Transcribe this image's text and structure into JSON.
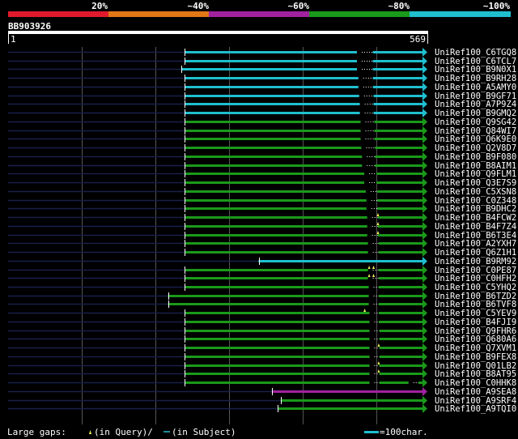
{
  "colors": {
    "background": "#000000",
    "dark_line": "#1a1f4a",
    "cyan": "#1fbfcf",
    "green": "#1a9a1a",
    "purple": "#a0229f",
    "red": "#e01a2c",
    "orange": "#e07818",
    "grid": "#555555",
    "white": "#ffffff"
  },
  "header": {
    "scale_labels": [
      "20%",
      "~40%",
      "~60%",
      "~80%",
      "~100%"
    ],
    "scale_colors": [
      "#e01a2c",
      "#e07818",
      "#a0229f",
      "#1a9a1a",
      "#1fbfcf"
    ],
    "query_id": "BB903926",
    "query_start": "1",
    "query_end": "569"
  },
  "footer": {
    "gaps_prefix": "Large gaps:",
    "gaps_query": "(in Query)/",
    "gaps_subject": "(in Subject)",
    "scale_text": "=100char."
  },
  "chart_data": {
    "type": "alignment",
    "query_length": 569,
    "rows": [
      {
        "label": "UniRef100_C6TGQ8",
        "color": "cyan",
        "start": 240,
        "end": 569,
        "dash": [
          480,
          495
        ],
        "query_gaps": [],
        "subject_gaps": []
      },
      {
        "label": "UniRef100_C6TCL7",
        "color": "cyan",
        "start": 240,
        "end": 569,
        "dash": [
          480,
          495
        ],
        "query_gaps": [],
        "subject_gaps": []
      },
      {
        "label": "UniRef100_B9N0X1",
        "color": "cyan",
        "start": 235,
        "end": 569,
        "dash": [
          480,
          495
        ],
        "query_gaps": [],
        "subject_gaps": []
      },
      {
        "label": "UniRef100_B9RH28",
        "color": "cyan",
        "start": 240,
        "end": 569,
        "dash": [
          482,
          495
        ],
        "query_gaps": [],
        "subject_gaps": []
      },
      {
        "label": "UniRef100_A5AMY0",
        "color": "cyan",
        "start": 240,
        "end": 569,
        "dash": [
          482,
          495
        ],
        "query_gaps": [],
        "subject_gaps": []
      },
      {
        "label": "UniRef100_B9GF71",
        "color": "cyan",
        "start": 240,
        "end": 569,
        "dash": [
          483,
          496
        ],
        "query_gaps": [],
        "subject_gaps": []
      },
      {
        "label": "UniRef100_A7P9Z4",
        "color": "cyan",
        "start": 240,
        "end": 569,
        "dash": [
          484,
          496
        ],
        "query_gaps": [],
        "subject_gaps": []
      },
      {
        "label": "UniRef100_B9GMQ2",
        "color": "cyan",
        "start": 240,
        "end": 569,
        "dash": [
          484,
          496
        ],
        "query_gaps": [],
        "subject_gaps": []
      },
      {
        "label": "UniRef100_Q9SG42",
        "color": "green",
        "start": 240,
        "end": 569,
        "dash": [
          485,
          497
        ],
        "query_gaps": [],
        "subject_gaps": []
      },
      {
        "label": "UniRef100_Q84WI7",
        "color": "green",
        "start": 240,
        "end": 569,
        "dash": [
          485,
          497
        ],
        "query_gaps": [],
        "subject_gaps": []
      },
      {
        "label": "UniRef100_Q6K9E0",
        "color": "green",
        "start": 240,
        "end": 569,
        "dash": [
          485,
          497
        ],
        "query_gaps": [],
        "subject_gaps": []
      },
      {
        "label": "UniRef100_Q2V8D7",
        "color": "green",
        "start": 240,
        "end": 569,
        "dash": [
          486,
          498
        ],
        "query_gaps": [],
        "subject_gaps": []
      },
      {
        "label": "UniRef100_B9F080",
        "color": "green",
        "start": 240,
        "end": 569,
        "dash": [
          487,
          498
        ],
        "query_gaps": [],
        "subject_gaps": []
      },
      {
        "label": "UniRef100_B8AIM1",
        "color": "green",
        "start": 240,
        "end": 569,
        "dash": [
          487,
          498
        ],
        "query_gaps": [],
        "subject_gaps": []
      },
      {
        "label": "UniRef100_Q9FLM1",
        "color": "green",
        "start": 240,
        "end": 569,
        "dash": [
          490,
          500
        ],
        "query_gaps": [],
        "subject_gaps": []
      },
      {
        "label": "UniRef100_Q3E7S9",
        "color": "green",
        "start": 240,
        "end": 569,
        "dash": [
          490,
          500
        ],
        "query_gaps": [],
        "subject_gaps": []
      },
      {
        "label": "UniRef100_C5XSN8",
        "color": "green",
        "start": 240,
        "end": 569,
        "dash": [
          492,
          501
        ],
        "query_gaps": [],
        "subject_gaps": []
      },
      {
        "label": "UniRef100_C0Z348",
        "color": "green",
        "start": 240,
        "end": 569,
        "dash": [
          493,
          501
        ],
        "query_gaps": [],
        "subject_gaps": []
      },
      {
        "label": "UniRef100_B9DHC2",
        "color": "green",
        "start": 240,
        "end": 569,
        "dash": [
          493,
          501
        ],
        "query_gaps": [],
        "subject_gaps": []
      },
      {
        "label": "UniRef100_B4FCW2",
        "color": "green",
        "start": 240,
        "end": 569,
        "dash": [
          494,
          502
        ],
        "query_gaps": [
          502
        ],
        "subject_gaps": []
      },
      {
        "label": "UniRef100_B4F7Z4",
        "color": "green",
        "start": 240,
        "end": 569,
        "dash": [
          494,
          502
        ],
        "query_gaps": [
          502
        ],
        "subject_gaps": []
      },
      {
        "label": "UniRef100_B6T3E4",
        "color": "green",
        "start": 240,
        "end": 569,
        "dash": [
          494,
          502
        ],
        "query_gaps": [
          502
        ],
        "subject_gaps": []
      },
      {
        "label": "UniRef100_A2YXH7",
        "color": "green",
        "start": 240,
        "end": 569,
        "dash": [
          495,
          503
        ],
        "query_gaps": [],
        "subject_gaps": []
      },
      {
        "label": "UniRef100_Q6Z1H1",
        "color": "green",
        "start": 240,
        "end": 569,
        "dash": [
          495,
          503
        ],
        "query_gaps": [],
        "subject_gaps": []
      },
      {
        "label": "UniRef100_B9RM92",
        "color": "cyan",
        "start": 340,
        "end": 569,
        "dash": [],
        "query_gaps": [],
        "subject_gaps": []
      },
      {
        "label": "UniRef100_C0PE87",
        "color": "green",
        "start": 240,
        "end": 569,
        "dash": [
          495,
          503
        ],
        "query_gaps": [
          490,
          496
        ],
        "subject_gaps": []
      },
      {
        "label": "UniRef100_C0HFH2",
        "color": "green",
        "start": 240,
        "end": 569,
        "dash": [
          495,
          503
        ],
        "query_gaps": [
          490,
          496
        ],
        "subject_gaps": []
      },
      {
        "label": "UniRef100_C5YHQ2",
        "color": "green",
        "start": 240,
        "end": 569,
        "dash": [
          496,
          503
        ],
        "query_gaps": [],
        "subject_gaps": []
      },
      {
        "label": "UniRef100_B6TZD2",
        "color": "green",
        "start": 217,
        "end": 569,
        "dash": [
          496,
          503
        ],
        "query_gaps": [],
        "subject_gaps": []
      },
      {
        "label": "UniRef100_B6TVF8",
        "color": "green",
        "start": 217,
        "end": 569,
        "dash": [
          496,
          503
        ],
        "query_gaps": [],
        "subject_gaps": []
      },
      {
        "label": "UniRef100_C5YEV9",
        "color": "green",
        "start": 240,
        "end": 569,
        "dash": [
          497,
          503
        ],
        "query_gaps": [
          484
        ],
        "subject_gaps": []
      },
      {
        "label": "UniRef100_B4FJI9",
        "color": "green",
        "start": 240,
        "end": 569,
        "dash": [
          497,
          503
        ],
        "query_gaps": [],
        "subject_gaps": []
      },
      {
        "label": "UniRef100_Q9FHR6",
        "color": "green",
        "start": 240,
        "end": 569,
        "dash": [
          497,
          504
        ],
        "query_gaps": [],
        "subject_gaps": []
      },
      {
        "label": "UniRef100_Q680A6",
        "color": "green",
        "start": 240,
        "end": 569,
        "dash": [
          497,
          504
        ],
        "query_gaps": [],
        "subject_gaps": []
      },
      {
        "label": "UniRef100_Q7XVM1",
        "color": "green",
        "start": 240,
        "end": 569,
        "dash": [
          497,
          504
        ],
        "query_gaps": [
          503
        ],
        "subject_gaps": []
      },
      {
        "label": "UniRef100_B9FEX8",
        "color": "green",
        "start": 240,
        "end": 569,
        "dash": [
          497,
          504
        ],
        "query_gaps": [],
        "subject_gaps": []
      },
      {
        "label": "UniRef100_Q01LB2",
        "color": "green",
        "start": 240,
        "end": 569,
        "dash": [
          497,
          504
        ],
        "query_gaps": [
          503
        ],
        "subject_gaps": []
      },
      {
        "label": "UniRef100_B8AT95",
        "color": "green",
        "start": 240,
        "end": 569,
        "dash": [
          497,
          504
        ],
        "query_gaps": [
          503
        ],
        "subject_gaps": []
      },
      {
        "label": "UniRef100_C0HHK8",
        "color": "green",
        "start": 240,
        "end": 569,
        "dash": [
          497,
          504,
          550,
          557
        ],
        "query_gaps": [],
        "subject_gaps": []
      },
      {
        "label": "UniRef100_A9SEA8",
        "color": "purple",
        "start": 358,
        "end": 569,
        "dash": [],
        "query_gaps": [],
        "subject_gaps": []
      },
      {
        "label": "UniRef100_A9SRF4",
        "color": "green",
        "start": 370,
        "end": 569,
        "dash": [],
        "query_gaps": [],
        "subject_gaps": []
      },
      {
        "label": "UniRef100_A9TQI0",
        "color": "green",
        "start": 366,
        "end": 569,
        "dash": [],
        "query_gaps": [],
        "subject_gaps": []
      }
    ]
  }
}
